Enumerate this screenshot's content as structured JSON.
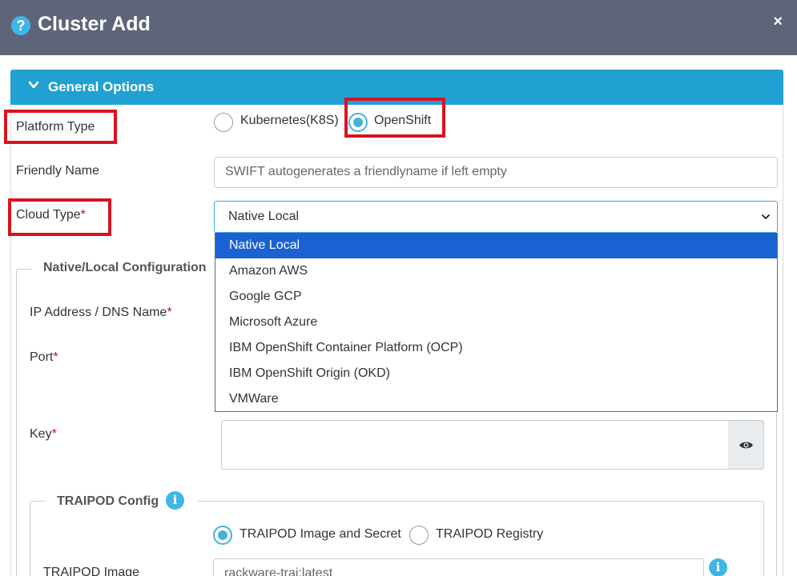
{
  "dialog": {
    "title": "Cluster Add",
    "help_icon": "?",
    "close_icon": "×"
  },
  "section": {
    "label": "General Options",
    "icon": "chevron-down-icon"
  },
  "platform_type": {
    "label": "Platform Type",
    "options": [
      {
        "label": "Kubernetes(K8S)",
        "selected": false
      },
      {
        "label": "OpenShift",
        "selected": true
      }
    ]
  },
  "friendly_name": {
    "label": "Friendly Name",
    "placeholder": "SWIFT autogenerates a friendlyname if left empty"
  },
  "cloud_type": {
    "label": "Cloud Type",
    "required_mark": "*",
    "value": "Native Local",
    "options": [
      "Native Local",
      "Amazon AWS",
      "Google GCP",
      "Microsoft Azure",
      "IBM OpenShift Container Platform (OCP)",
      "IBM OpenShift Origin (OKD)",
      "VMWare"
    ]
  },
  "native_config": {
    "legend": "Native/Local Configuration",
    "ip_label": "IP Address / DNS Name",
    "port_label": "Port",
    "key_label": "Key",
    "required_mark": "*"
  },
  "traipod": {
    "legend": "TRAIPOD Config",
    "info_icon": "i",
    "options": [
      {
        "label": "TRAIPOD Image and Secret",
        "selected": true
      },
      {
        "label": "TRAIPOD Registry",
        "selected": false
      }
    ],
    "image_label": "TRAIPOD Image",
    "image_value": "rackware-trai:latest"
  },
  "colors": {
    "header": "#5f6578",
    "section": "#21a1d1",
    "accent": "#45b3d8",
    "highlight": "#d9131f",
    "selected_option": "#1a62d3"
  }
}
